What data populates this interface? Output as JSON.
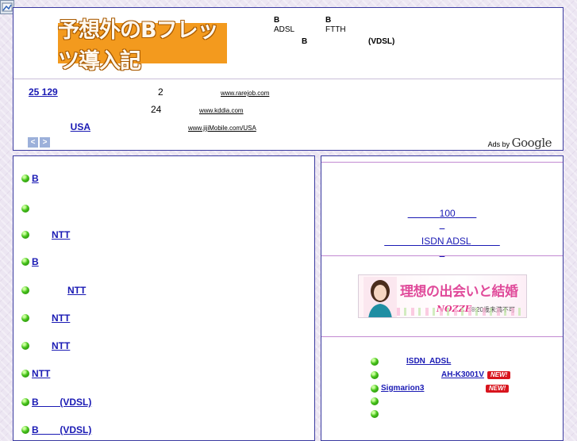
{
  "logo": {
    "text": "予想外のBフレッツ導入記"
  },
  "header_text": {
    "b1": "B",
    "b2": "B",
    "adsl": "ADSL",
    "ftth": "FTTH",
    "b3": "B",
    "vdsl": "(VDSL)"
  },
  "ads": {
    "items": [
      {
        "link": "25  129",
        "num": "2",
        "url": "www.rarejob.com"
      },
      {
        "link": "",
        "num": "24",
        "url": "www.kddia.com"
      },
      {
        "link": "USA",
        "num": "",
        "url": "www.jijiMobile.com/USA"
      }
    ],
    "prev": "<",
    "next": ">",
    "ads_by": "Ads by",
    "google": "Google"
  },
  "left_menu": [
    "B",
    "",
    "NTT",
    "B",
    "NTT",
    "NTT",
    "NTT",
    "NTT",
    "B        (VDSL)",
    "B        (VDSL)"
  ],
  "right": {
    "link_100": "100",
    "link_isdn": "ISDN ADSL",
    "banner": {
      "headline": "理想の出会いと結婚",
      "brand": "NOZZE",
      "note": "※20歳未満不可"
    },
    "items": [
      {
        "label": "ISDN  ADSL",
        "new": false
      },
      {
        "label": "AH-K3001V",
        "new": true
      },
      {
        "label": "Sigmarion3",
        "new": true
      },
      {
        "label": "",
        "new": false
      },
      {
        "label": "",
        "new": false
      }
    ],
    "new_badge": "NEW!"
  },
  "colors": {
    "link": "#1a1ab4",
    "border": "#3a3aa0",
    "logo_bg": "#f39a1e",
    "new_badge": "#d8141d"
  }
}
